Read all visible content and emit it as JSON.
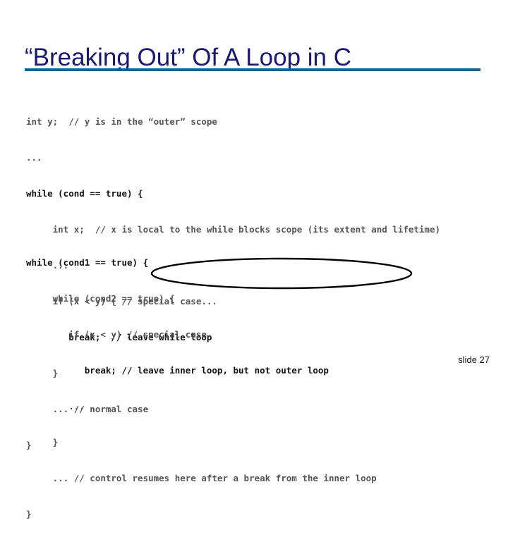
{
  "slide": {
    "title": "“Breaking Out” Of A Loop in C",
    "footer": "slide 27",
    "accent_color": "#176285",
    "title_color": "#191970",
    "background_color": "#ffffff",
    "annotation_color": "#000000"
  },
  "code_block_1": {
    "lines": [
      "int y;  // y is in the “outer” scope",
      "...",
      "while (cond == true) {",
      "     int x;  // x is local to the while blocks scope (its extent and lifetime)",
      "     ...",
      "     if (x < y) { // special case...",
      "        break;  // leave while loop",
      "     }",
      "     ... // normal case",
      "}"
    ]
  },
  "code_block_2": {
    "lines": [
      "while (cond1 == true) {",
      "     while (cond2 == true) {",
      "        if (x < y) // special case",
      "           break; // leave inner loop, but not outer loop",
      "        ...",
      "     }",
      "     ... // control resumes here after a break from the inner loop",
      "}"
    ]
  },
  "annotation": {
    "shape": "ellipse",
    "encircles": "break; // leave inner loop, but not outer loop"
  }
}
